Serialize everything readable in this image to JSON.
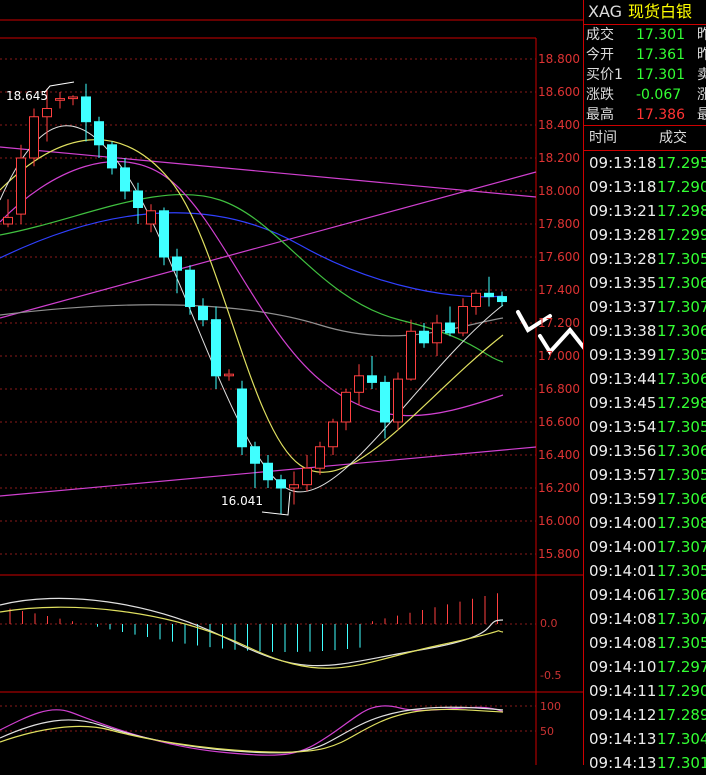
{
  "chart": {
    "price_axis": [
      "18.800",
      "18.600",
      "18.400",
      "18.200",
      "18.000",
      "17.800",
      "17.600",
      "17.400",
      "17.200",
      "17.000",
      "16.800",
      "16.600",
      "16.400",
      "16.200",
      "16.000",
      "15.800"
    ],
    "high_marker": "18.645",
    "low_marker": "16.041",
    "macd_axis": [
      "0.0",
      "-0.5"
    ],
    "kdj_axis": [
      "100",
      "50"
    ]
  },
  "quote": {
    "symbol": "XAG",
    "name": "现货白银",
    "rows": [
      {
        "label": "成交",
        "value": "17.301",
        "ext": "昨",
        "color": "g"
      },
      {
        "label": "今开",
        "value": "17.361",
        "ext": "昨",
        "color": "g"
      },
      {
        "label": "买价1",
        "value": "17.301",
        "ext": "卖",
        "color": "g"
      },
      {
        "label": "涨跌",
        "value": "-0.067",
        "ext": "涨",
        "color": "g"
      },
      {
        "label": "最高",
        "value": "17.386",
        "ext": "最",
        "color": "r"
      }
    ],
    "tick_headers": {
      "time": "时间",
      "price": "成交"
    }
  },
  "ticks": [
    {
      "t": "09:13:18",
      "p": "17.295"
    },
    {
      "t": "09:13:18",
      "p": "17.290"
    },
    {
      "t": "09:13:21",
      "p": "17.298"
    },
    {
      "t": "09:13:28",
      "p": "17.299"
    },
    {
      "t": "09:13:28",
      "p": "17.305"
    },
    {
      "t": "09:13:35",
      "p": "17.306"
    },
    {
      "t": "09:13:37",
      "p": "17.307"
    },
    {
      "t": "09:13:38",
      "p": "17.306"
    },
    {
      "t": "09:13:39",
      "p": "17.305"
    },
    {
      "t": "09:13:44",
      "p": "17.306"
    },
    {
      "t": "09:13:45",
      "p": "17.298"
    },
    {
      "t": "09:13:54",
      "p": "17.305"
    },
    {
      "t": "09:13:56",
      "p": "17.306"
    },
    {
      "t": "09:13:57",
      "p": "17.305"
    },
    {
      "t": "09:13:59",
      "p": "17.306"
    },
    {
      "t": "09:14:00",
      "p": "17.308"
    },
    {
      "t": "09:14:00",
      "p": "17.307"
    },
    {
      "t": "09:14:01",
      "p": "17.305"
    },
    {
      "t": "09:14:06",
      "p": "17.306"
    },
    {
      "t": "09:14:08",
      "p": "17.307"
    },
    {
      "t": "09:14:08",
      "p": "17.305"
    },
    {
      "t": "09:14:10",
      "p": "17.297"
    },
    {
      "t": "09:14:11",
      "p": "17.290"
    },
    {
      "t": "09:14:12",
      "p": "17.289"
    },
    {
      "t": "09:14:13",
      "p": "17.304"
    },
    {
      "t": "09:14:13",
      "p": "17.301"
    }
  ],
  "candles": [
    {
      "o": 17.8,
      "h": 17.95,
      "l": 17.78,
      "c": 17.84
    },
    {
      "o": 17.86,
      "h": 18.28,
      "l": 17.8,
      "c": 18.2
    },
    {
      "o": 18.2,
      "h": 18.5,
      "l": 18.15,
      "c": 18.45
    },
    {
      "o": 18.45,
      "h": 18.62,
      "l": 18.3,
      "c": 18.5
    },
    {
      "o": 18.55,
      "h": 18.6,
      "l": 18.5,
      "c": 18.56
    },
    {
      "o": 18.56,
      "h": 18.58,
      "l": 18.52,
      "c": 18.57
    },
    {
      "o": 18.57,
      "h": 18.65,
      "l": 18.3,
      "c": 18.42
    },
    {
      "o": 18.42,
      "h": 18.45,
      "l": 18.2,
      "c": 18.28
    },
    {
      "o": 18.28,
      "h": 18.3,
      "l": 18.1,
      "c": 18.14
    },
    {
      "o": 18.14,
      "h": 18.2,
      "l": 17.95,
      "c": 18.0
    },
    {
      "o": 18.0,
      "h": 18.05,
      "l": 17.8,
      "c": 17.9
    },
    {
      "o": 17.8,
      "h": 17.92,
      "l": 17.75,
      "c": 17.88
    },
    {
      "o": 17.88,
      "h": 17.9,
      "l": 17.55,
      "c": 17.6
    },
    {
      "o": 17.6,
      "h": 17.65,
      "l": 17.38,
      "c": 17.52
    },
    {
      "o": 17.52,
      "h": 17.55,
      "l": 17.25,
      "c": 17.3
    },
    {
      "o": 17.3,
      "h": 17.35,
      "l": 17.18,
      "c": 17.22
    },
    {
      "o": 17.22,
      "h": 17.3,
      "l": 16.8,
      "c": 16.88
    },
    {
      "o": 16.88,
      "h": 16.92,
      "l": 16.85,
      "c": 16.89
    },
    {
      "o": 16.8,
      "h": 16.85,
      "l": 16.4,
      "c": 16.45
    },
    {
      "o": 16.45,
      "h": 16.48,
      "l": 16.2,
      "c": 16.35
    },
    {
      "o": 16.35,
      "h": 16.4,
      "l": 16.2,
      "c": 16.25
    },
    {
      "o": 16.25,
      "h": 16.28,
      "l": 16.04,
      "c": 16.2
    },
    {
      "o": 16.2,
      "h": 16.3,
      "l": 16.1,
      "c": 16.22
    },
    {
      "o": 16.22,
      "h": 16.4,
      "l": 16.18,
      "c": 16.32
    },
    {
      "o": 16.32,
      "h": 16.48,
      "l": 16.28,
      "c": 16.45
    },
    {
      "o": 16.45,
      "h": 16.62,
      "l": 16.4,
      "c": 16.6
    },
    {
      "o": 16.6,
      "h": 16.8,
      "l": 16.55,
      "c": 16.78
    },
    {
      "o": 16.78,
      "h": 16.95,
      "l": 16.7,
      "c": 16.88
    },
    {
      "o": 16.88,
      "h": 17.0,
      "l": 16.8,
      "c": 16.84
    },
    {
      "o": 16.84,
      "h": 16.88,
      "l": 16.5,
      "c": 16.6
    },
    {
      "o": 16.6,
      "h": 16.9,
      "l": 16.55,
      "c": 16.86
    },
    {
      "o": 16.86,
      "h": 17.22,
      "l": 16.85,
      "c": 17.15
    },
    {
      "o": 17.15,
      "h": 17.2,
      "l": 17.05,
      "c": 17.08
    },
    {
      "o": 17.08,
      "h": 17.25,
      "l": 17.0,
      "c": 17.2
    },
    {
      "o": 17.2,
      "h": 17.3,
      "l": 17.12,
      "c": 17.14
    },
    {
      "o": 17.14,
      "h": 17.35,
      "l": 17.12,
      "c": 17.3
    },
    {
      "o": 17.3,
      "h": 17.4,
      "l": 17.25,
      "c": 17.38
    },
    {
      "o": 17.38,
      "h": 17.48,
      "l": 17.3,
      "c": 17.36
    },
    {
      "o": 17.36,
      "h": 17.39,
      "l": 17.3,
      "c": 17.33
    }
  ]
}
